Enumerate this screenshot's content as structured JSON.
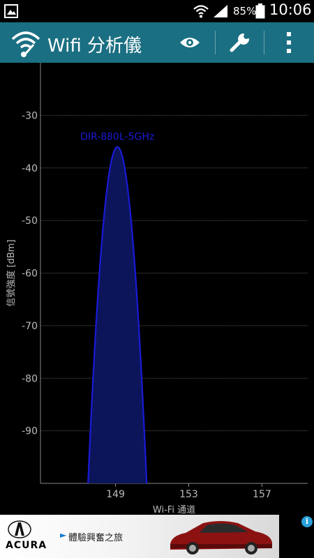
{
  "status_bar": {
    "battery": "85%",
    "time": "10:06"
  },
  "app_bar": {
    "title": "Wifi 分析儀",
    "icons": [
      "eye-icon",
      "wrench-icon",
      "overflow-menu-icon"
    ],
    "background": "#1b6f82"
  },
  "chart_data": {
    "type": "area",
    "title": "",
    "xlabel": "Wi-Fi 通道",
    "ylabel": "信號強度 [dBm]",
    "x_ticks": [
      149,
      153,
      157
    ],
    "y_ticks": [
      -30,
      -40,
      -50,
      -60,
      -70,
      -80,
      -90
    ],
    "xlim": [
      144.9,
      159.5
    ],
    "ylim": [
      -100,
      -20
    ],
    "grid": true,
    "series": [
      {
        "name": "DIR-880L-5GHz",
        "channel": 149,
        "channel_span": [
          147.5,
          150.7
        ],
        "peak_dbm": -36,
        "color": "#1a1ad6",
        "fill": "#0c1559"
      }
    ]
  },
  "ad": {
    "brand": "ACURA",
    "text": "體驗興奮之旅",
    "info_icon": "i"
  }
}
